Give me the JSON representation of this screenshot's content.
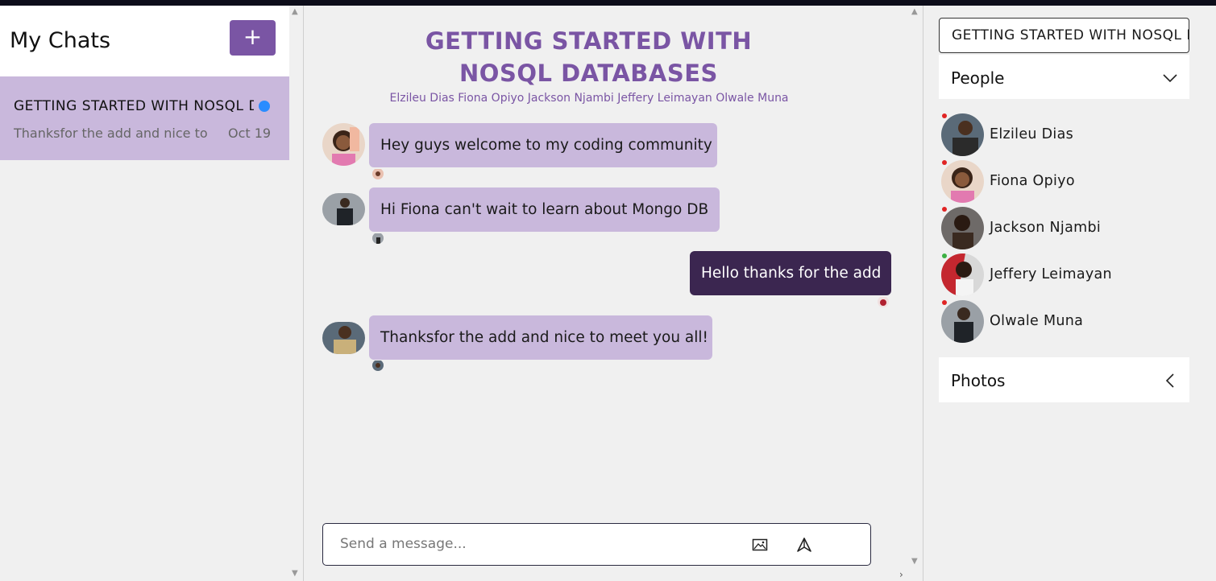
{
  "left": {
    "title": "My Chats",
    "add_label": "+",
    "chats": [
      {
        "name": "GETTING STARTED WITH NOSQL DATABASES",
        "preview": "Thanksfor the add and nice to meet you all!",
        "date": "Oct 19",
        "unread": true
      }
    ]
  },
  "chat": {
    "title": "GETTING STARTED WITH NOSQL DATABASES",
    "members": "Elzileu Dias Fiona Opiyo Jackson Njambi Jeffery Leimayan Olwale Muna",
    "messages": [
      {
        "text": "Hey guys welcome to my coding community",
        "direction": "in",
        "sender_avatar": "fiona-avatar"
      },
      {
        "text": "Hi Fiona can't wait to learn about Mongo DB",
        "direction": "in",
        "sender_avatar": "olwale-avatar"
      },
      {
        "text": "Hello thanks for the add",
        "direction": "out",
        "sender_avatar": "me-avatar"
      },
      {
        "text": "Thanksfor the add and nice to meet you all!",
        "direction": "in",
        "sender_avatar": "elzileu-avatar"
      }
    ],
    "composer": {
      "placeholder": "Send a message..."
    }
  },
  "right": {
    "title": "GETTING STARTED WITH NOSQL DATABASES",
    "people_label": "People",
    "photos_label": "Photos",
    "people": [
      {
        "name": "Elzileu Dias",
        "status": "offline"
      },
      {
        "name": "Fiona Opiyo",
        "status": "offline"
      },
      {
        "name": "Jackson Njambi",
        "status": "offline"
      },
      {
        "name": "Jeffery Leimayan",
        "status": "online"
      },
      {
        "name": "Olwale Muna",
        "status": "offline"
      }
    ]
  },
  "colors": {
    "accent": "#7a55a4",
    "bubble_in": "#c9b8dc",
    "bubble_out": "#3b2650",
    "online": "#3cb043",
    "offline": "#e02424",
    "unread": "#2a8cff"
  }
}
